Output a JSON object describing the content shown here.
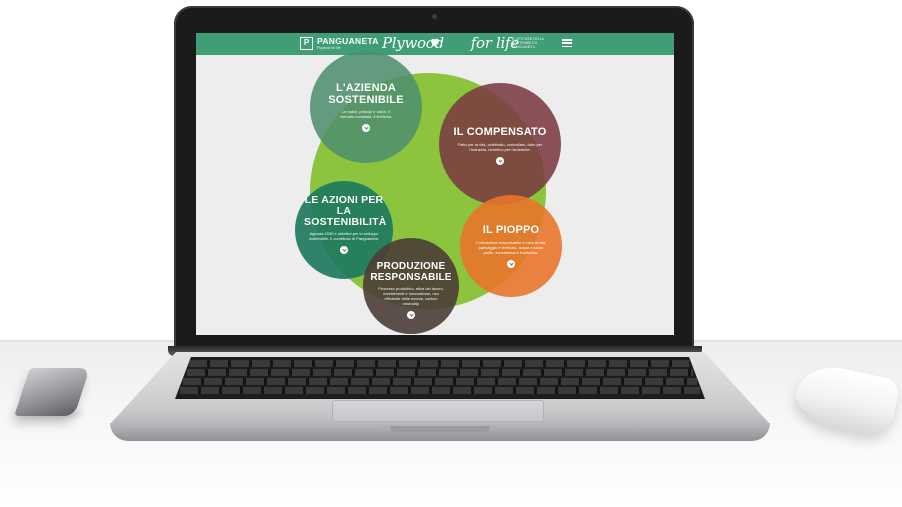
{
  "site": {
    "brand": "PANGUANETA",
    "brand_sub": "Plywood for life",
    "logo_letter": "P",
    "script_left": "Plywood",
    "script_right": "for life",
    "tagline": "IL SITO WEB DELLA SOSTENIBILITÀ PANGUANETA"
  },
  "bubbles": [
    {
      "id": "azienda",
      "title": "L'AZIENDA SOSTENIBILE",
      "text": "Le radici, principi e valori, il mercato mondiale, il territorio.",
      "color": "#4e8f6d"
    },
    {
      "id": "compensato",
      "title": "IL COMPENSATO",
      "text": "Fatto per la vita, certificato, controllato, fatto per l'industria, benefico per l'ambiente.",
      "color": "#7b3b42"
    },
    {
      "id": "azioni",
      "title": "LE AZIONI PER LA SOSTENIBILITÀ",
      "text": "Agenda 2030 e obiettivi per lo sviluppo sostenibile. Il contributo di Panguaneta.",
      "color": "#1e7a5e"
    },
    {
      "id": "pioppo",
      "title": "IL PIOPPO",
      "text": "Coltivazione responsabile e cura di vita, paesaggio e territorio, acqua e suolo pulito, ecosistema e tradizione.",
      "color": "#e8752a"
    },
    {
      "id": "produzione",
      "title": "PRODUZIONE RESPONSABILE",
      "text": "Processo produttivo, etica del lavoro, investimenti e innovazione, uso efficiente delle risorse, carbon neutrality.",
      "color": "#4b3d36"
    }
  ],
  "colors": {
    "header_green": "#3f9e76",
    "lime": "#8cc43e",
    "screen_bg": "#ededee"
  }
}
